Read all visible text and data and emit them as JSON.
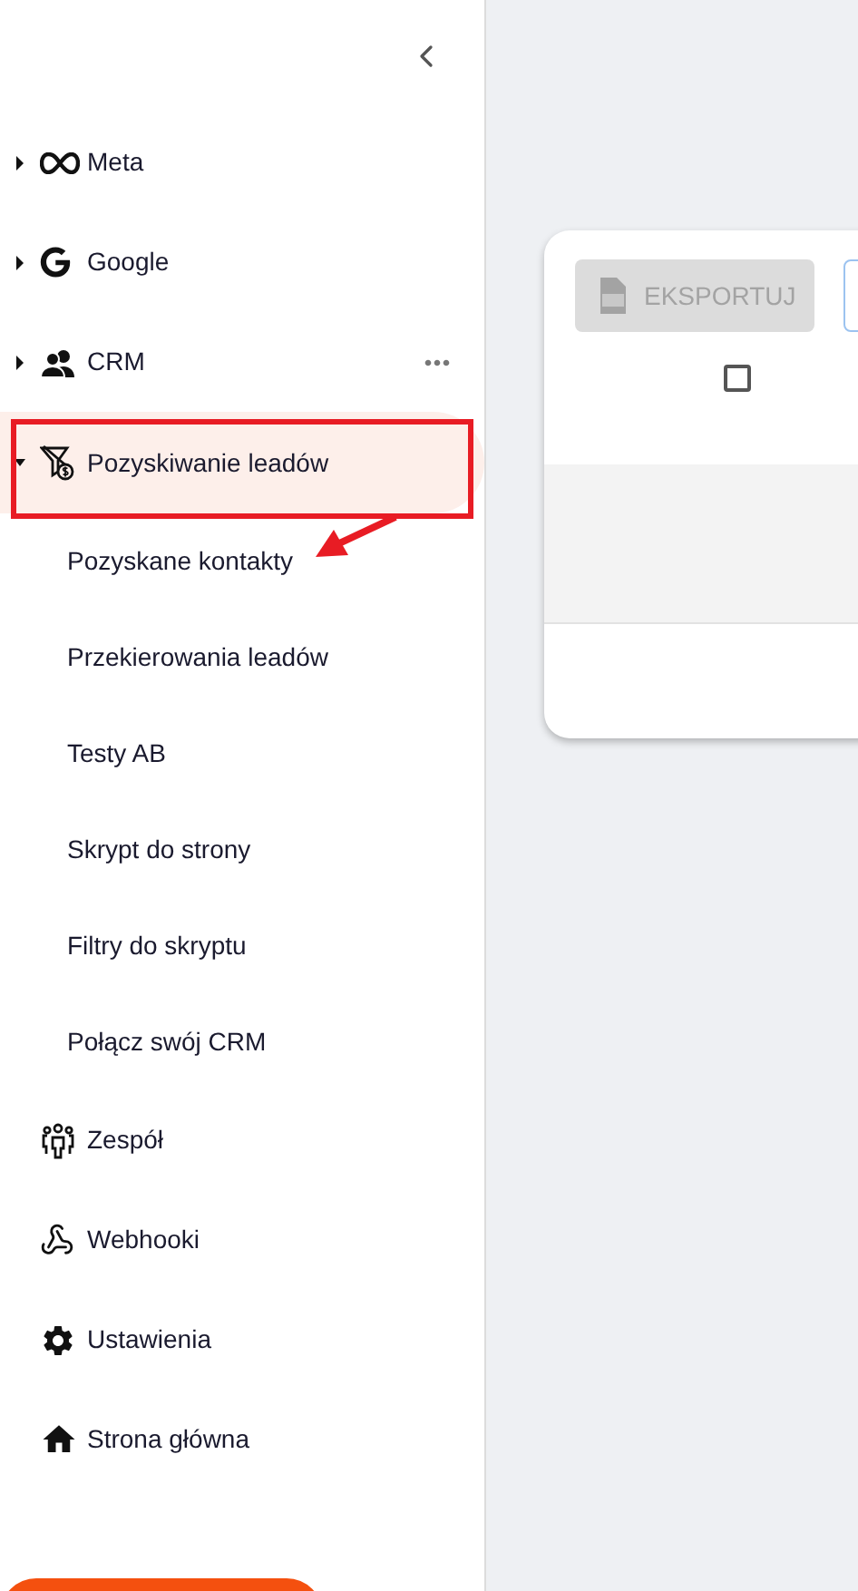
{
  "sidebar": {
    "items": [
      {
        "kind": "group",
        "label": "Meta",
        "expanded": false,
        "selected": false,
        "has_menu": false
      },
      {
        "kind": "group",
        "label": "Google",
        "expanded": false,
        "selected": false,
        "has_menu": false
      },
      {
        "kind": "group",
        "label": "CRM",
        "expanded": false,
        "selected": false,
        "has_menu": true
      },
      {
        "kind": "group",
        "label": "Pozyskiwanie leadów",
        "expanded": true,
        "selected": true,
        "has_menu": false,
        "children": [
          {
            "label": "Pozyskane kontakty",
            "selected": false
          },
          {
            "label": "Przekierowania leadów",
            "selected": false
          },
          {
            "label": "Testy AB",
            "selected": false
          },
          {
            "label": "Skrypt do strony",
            "selected": false
          },
          {
            "label": "Filtry do skryptu",
            "selected": false
          },
          {
            "label": "Połącz swój CRM",
            "selected": false
          }
        ]
      },
      {
        "kind": "link",
        "label": "Zespół",
        "selected": false
      },
      {
        "kind": "link",
        "label": "Webhooki",
        "selected": false
      },
      {
        "kind": "link",
        "label": "Ustawienia",
        "selected": false
      },
      {
        "kind": "link",
        "label": "Strona główna",
        "selected": false
      }
    ]
  },
  "table_card": {
    "export_button": {
      "label": "EKSPORTUJ",
      "disabled": true
    },
    "select_all": {
      "checked": false
    }
  }
}
